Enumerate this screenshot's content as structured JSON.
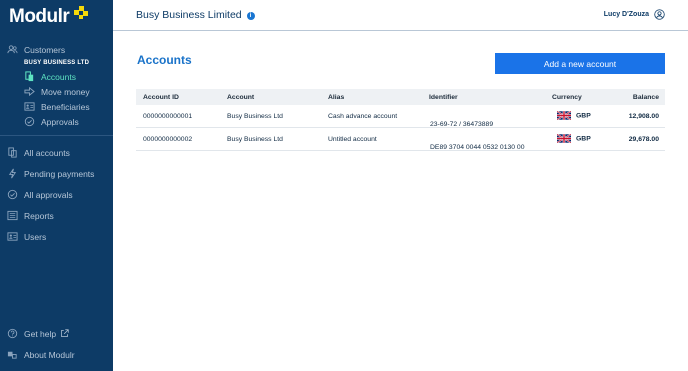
{
  "sidebar": {
    "logo": "Modulr",
    "customers_label": "Customers",
    "business_name": "BUSY BUSINESS LTD",
    "sub_items": [
      {
        "label": "Accounts",
        "icon": "accounts-icon",
        "active": true
      },
      {
        "label": "Move money",
        "icon": "arrow-right-icon",
        "active": false
      },
      {
        "label": "Beneficiaries",
        "icon": "beneficiaries-icon",
        "active": false
      },
      {
        "label": "Approvals",
        "icon": "check-circle-icon",
        "active": false
      }
    ],
    "main_items": [
      {
        "label": "All accounts",
        "icon": "accounts-icon"
      },
      {
        "label": "Pending payments",
        "icon": "lightning-icon"
      },
      {
        "label": "All approvals",
        "icon": "check-circle-icon"
      },
      {
        "label": "Reports",
        "icon": "reports-icon"
      },
      {
        "label": "Users",
        "icon": "users-icon"
      }
    ],
    "bottom_items": [
      {
        "label": "Get help",
        "icon": "help-icon"
      },
      {
        "label": "About Modulr",
        "icon": "about-icon"
      }
    ],
    "active_color": "#5ee3c1",
    "background": "#0d3b66"
  },
  "header": {
    "company": "Busy Business Limited",
    "user": "Lucy D'Zouza"
  },
  "main": {
    "title": "Accounts",
    "add_button": "Add a new account",
    "columns": [
      "Account ID",
      "Account",
      "Alias",
      "Identifier",
      "Currency",
      "Balance"
    ],
    "rows": [
      {
        "account_id": "0000000000001",
        "account": "Busy Business Ltd",
        "alias": "Cash advance account",
        "identifier": "23-69-72 / 36473889",
        "currency": "GBP",
        "balance": "12,908.00"
      },
      {
        "account_id": "0000000000002",
        "account": "Busy Business Ltd",
        "alias": "Untitled account",
        "identifier": "DE89 3704 0044 0532 0130 00",
        "currency": "GBP",
        "balance": "29,678.00"
      }
    ]
  },
  "colors": {
    "accent": "#1a73e8",
    "title_blue": "#1a73c9"
  }
}
